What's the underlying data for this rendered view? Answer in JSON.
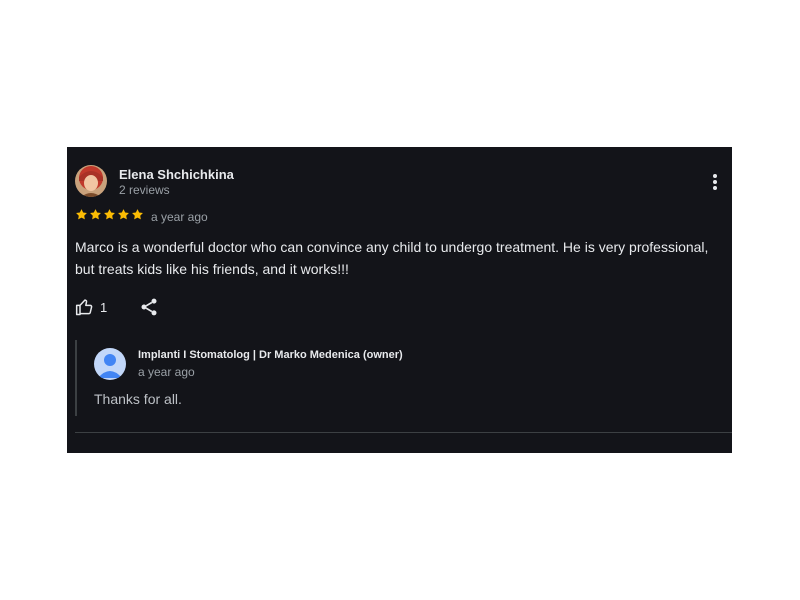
{
  "review": {
    "author_name": "Elena Shchichkina",
    "author_meta": "2 reviews",
    "rating": 5,
    "time": "a year ago",
    "text": "Marco is a wonderful doctor who can convince any child to undergo treatment. He is very professional, but treats kids like his friends, and it works!!!",
    "likes": "1"
  },
  "owner_reply": {
    "author": "Implanti I Stomatolog | Dr Marko Medenica (owner)",
    "time": "a year ago",
    "text": "Thanks for all."
  },
  "icons": {
    "more": "more-vert-icon",
    "like": "thumb-up-icon",
    "share": "share-icon",
    "star": "star-icon"
  },
  "colors": {
    "card_background": "#131419",
    "star": "#fbbc04",
    "owner_avatar": "#8ab4f8"
  }
}
